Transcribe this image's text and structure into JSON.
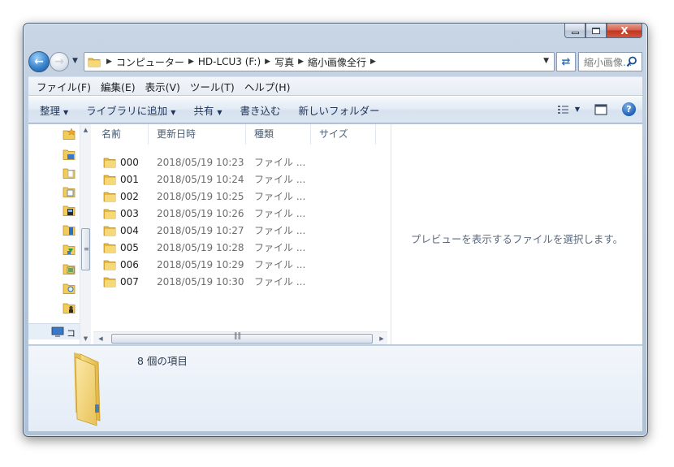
{
  "window": {
    "minimize_glyph": "minimize-icon",
    "maximize_glyph": "maximize-icon",
    "close_label": "X"
  },
  "address_bar": {
    "crumbs": [
      "コンピューター",
      "HD-LCU3 (F:)",
      "写真",
      "縮小画像全行"
    ]
  },
  "search": {
    "placeholder": "縮小画像..."
  },
  "menu": {
    "items": [
      "ファイル(F)",
      "編集(E)",
      "表示(V)",
      "ツール(T)",
      "ヘルプ(H)"
    ]
  },
  "commands": {
    "organize": "整理",
    "add_to_library": "ライブラリに追加",
    "share": "共有",
    "burn": "書き込む",
    "new_folder": "新しいフォルダー"
  },
  "columns": {
    "name": "名前",
    "date": "更新日時",
    "type": "種類",
    "size": "サイズ"
  },
  "files": [
    {
      "name": "000",
      "date": "2018/05/19 10:23",
      "type": "ファイル ..."
    },
    {
      "name": "001",
      "date": "2018/05/19 10:24",
      "type": "ファイル ..."
    },
    {
      "name": "002",
      "date": "2018/05/19 10:25",
      "type": "ファイル ..."
    },
    {
      "name": "003",
      "date": "2018/05/19 10:26",
      "type": "ファイル ..."
    },
    {
      "name": "004",
      "date": "2018/05/19 10:27",
      "type": "ファイル ..."
    },
    {
      "name": "005",
      "date": "2018/05/19 10:28",
      "type": "ファイル ..."
    },
    {
      "name": "006",
      "date": "2018/05/19 10:29",
      "type": "ファイル ..."
    },
    {
      "name": "007",
      "date": "2018/05/19 10:30",
      "type": "ファイル ..."
    }
  ],
  "preview": {
    "message": "プレビューを表示するファイルを選択します。"
  },
  "details": {
    "item_count": "8 個の項目"
  },
  "colors": {
    "folder_yellow": "#f1cb5c",
    "accent_blue": "#2a6fc0",
    "close_red": "#c2351f"
  }
}
